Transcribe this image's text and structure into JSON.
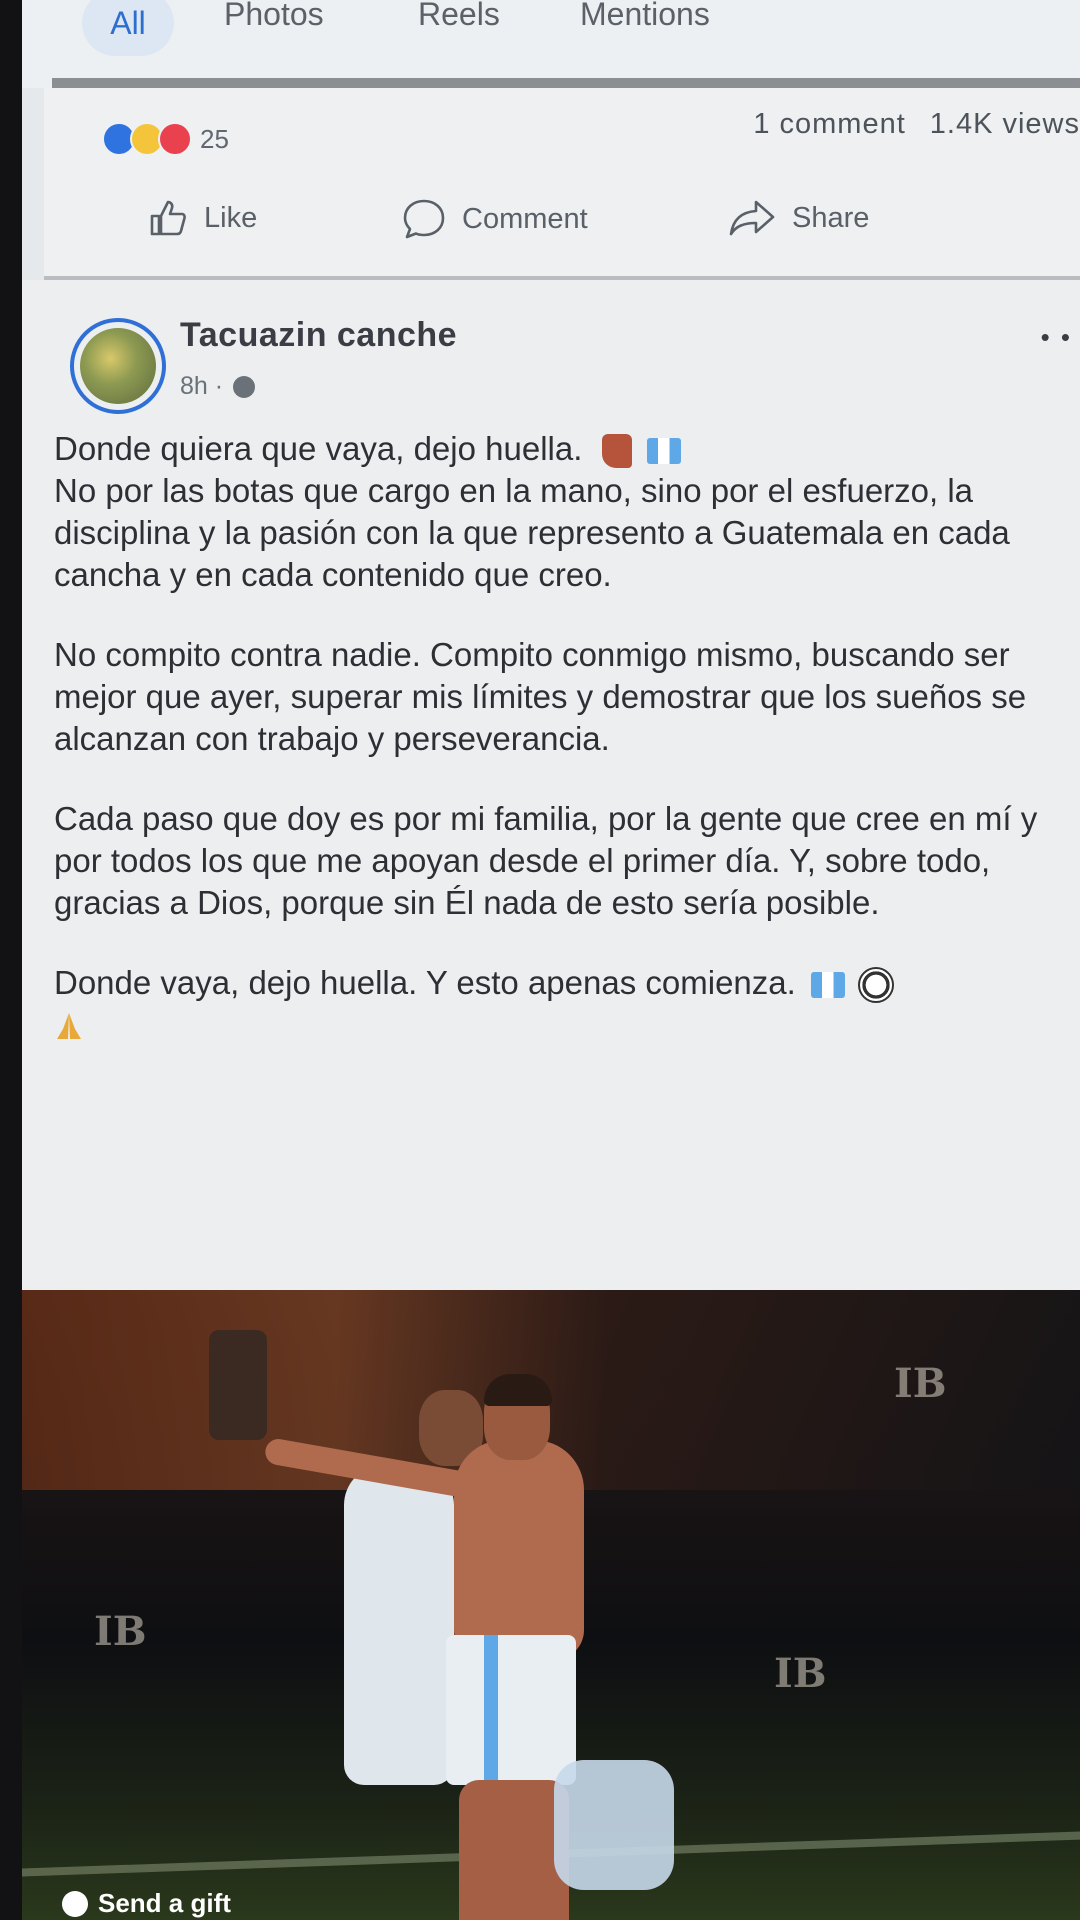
{
  "tabs": {
    "items": [
      {
        "label": "All",
        "active": true
      },
      {
        "label": "Photos",
        "active": false
      },
      {
        "label": "Reels",
        "active": false
      },
      {
        "label": "Mentions",
        "active": false
      }
    ]
  },
  "previous_post": {
    "reactions": {
      "icons": [
        "like-reaction",
        "haha-reaction",
        "love-reaction"
      ],
      "count": "25"
    },
    "comments": "1 comment",
    "views": "1.4K views",
    "actions": {
      "like": "Like",
      "comment": "Comment",
      "share": "Share"
    }
  },
  "post": {
    "author": "Tacuazin canche",
    "time": "8h ·",
    "caption": {
      "p1_line1": "Donde quiera que vaya, dejo huella.",
      "p1_rest": "No por las botas que cargo en la mano, sino por el esfuerzo, la disciplina y la pasión con la que represento a Guatemala en cada cancha y en cada contenido que creo.",
      "p2": "No compito contra nadie. Compito conmigo mismo, buscando ser mejor que ayer, superar mis límites y demostrar que los sueños se alcanzan con trabajo y perseverancia.",
      "p3": "Cada paso que doy es por mi familia, por la gente que cree en mí y por todos los que me apoyan desde el primer día. Y, sobre todo, gracias a Dios, porque sin Él nada de esto sería posible.",
      "p4": "Donde vaya, dejo huella. Y esto apenas comienza."
    },
    "photo": {
      "send_gift": "Send a gift"
    }
  },
  "colors": {
    "accent": "#2d6fcf",
    "screen_bg": "#eceef0",
    "like": "#2f73e0",
    "love": "#e9414e",
    "haha": "#f4c53b"
  }
}
